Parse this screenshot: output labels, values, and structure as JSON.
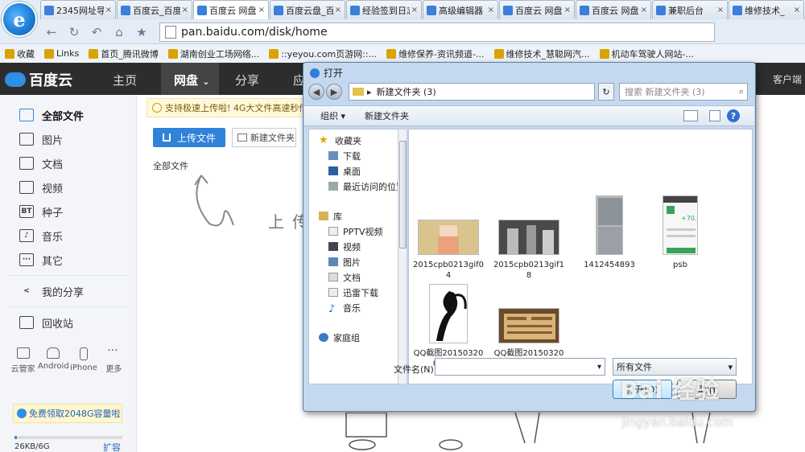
{
  "browser": {
    "logo": "e",
    "tabs": [
      {
        "label": "2345网址导",
        "active": false
      },
      {
        "label": "百度云_百度",
        "active": false
      },
      {
        "label": "百度云 网盘",
        "active": true
      },
      {
        "label": "百度云盘_百",
        "active": false
      },
      {
        "label": "经验签到日志",
        "active": false
      },
      {
        "label": "高级编辑器",
        "active": false
      },
      {
        "label": "百度云 网盘",
        "active": false
      },
      {
        "label": "百度云 网盘",
        "active": false
      },
      {
        "label": "兼职后台",
        "active": false
      },
      {
        "label": "维修技术_",
        "active": false
      }
    ],
    "tab_close": "×",
    "nav": {
      "back": "←",
      "refresh": "↻",
      "undo": "↶",
      "home": "⌂",
      "star": "★"
    },
    "address": "pan.baidu.com/disk/home",
    "bookmarks": [
      "收藏",
      "Links",
      "首页_腾讯微博",
      "湖南创业工场网络...",
      "::yeyou.com页游网::...",
      "维修保养-资讯频道-...",
      "维修技术_慧聪网汽...",
      "机动车驾驶人网站-..."
    ]
  },
  "header": {
    "logo": "百度云",
    "nav": {
      "home": "主页",
      "disk": "网盘",
      "share": "分享",
      "app": "应"
    },
    "disk_caret": "⌄",
    "client": "客户端"
  },
  "sidebar": {
    "items": [
      {
        "label": "全部文件",
        "icon": "cloud-icon",
        "glyph": "",
        "active": true
      },
      {
        "label": "图片",
        "icon": "image-icon",
        "glyph": "",
        "active": false
      },
      {
        "label": "文档",
        "icon": "document-icon",
        "glyph": "",
        "active": false
      },
      {
        "label": "视频",
        "icon": "video-icon",
        "glyph": "",
        "active": false
      },
      {
        "label": "种子",
        "icon": "torrent-icon",
        "glyph": "BT",
        "active": false
      },
      {
        "label": "音乐",
        "icon": "music-icon",
        "glyph": "♪",
        "active": false
      },
      {
        "label": "其它",
        "icon": "more-icon",
        "glyph": "···",
        "active": false
      }
    ],
    "share": {
      "label": "我的分享",
      "icon": "share-icon"
    },
    "recycle": {
      "label": "回收站",
      "icon": "trash-icon"
    },
    "devices": [
      "云管家",
      "Android",
      "iPhone",
      "更多"
    ],
    "promo": "免费领取2048G容量啦~",
    "quota": "26KB/6G",
    "quota_fraction": 0.01,
    "expand": "扩容"
  },
  "main": {
    "notice": "支持极速上传啦! 4G大文件高速秒传,",
    "upload": "上传文件",
    "new_folder": "新建文件夹",
    "crumb": "全部文件",
    "hint": "上传"
  },
  "dialog": {
    "title": "打开",
    "path_prefix": "▸",
    "path": "新建文件夹 (3)",
    "search_placeholder": "搜索 新建文件夹 (3)",
    "organize": "组织 ▾",
    "new_folder": "新建文件夹",
    "help": "?",
    "nav": {
      "favorites": "收藏夹",
      "downloads": "下载",
      "desktop": "桌面",
      "recent": "最近访问的位置",
      "library": "库",
      "pptv": "PPTV视频",
      "video": "视频",
      "pictures": "图片",
      "documents": "文档",
      "thunder": "迅雷下载",
      "music": "音乐",
      "homegroup": "家庭组"
    },
    "files": [
      {
        "name": "2015cpb0213gif04"
      },
      {
        "name": "2015cpb0213gif18"
      },
      {
        "name": "1412454893"
      },
      {
        "name": "psb"
      },
      {
        "name": "QQ截图20150320092745"
      },
      {
        "name": "QQ截图20150320134242"
      }
    ],
    "psb_price": "+70.00",
    "filename_label": "文件名(N):",
    "filename_value": "",
    "filetype": "所有文件",
    "open": "打开(O)",
    "cancel": "取消",
    "dropdown_arrow": "▾"
  },
  "watermark": {
    "brand": "Bai 经验",
    "url": "jingyan.baidu.com"
  }
}
